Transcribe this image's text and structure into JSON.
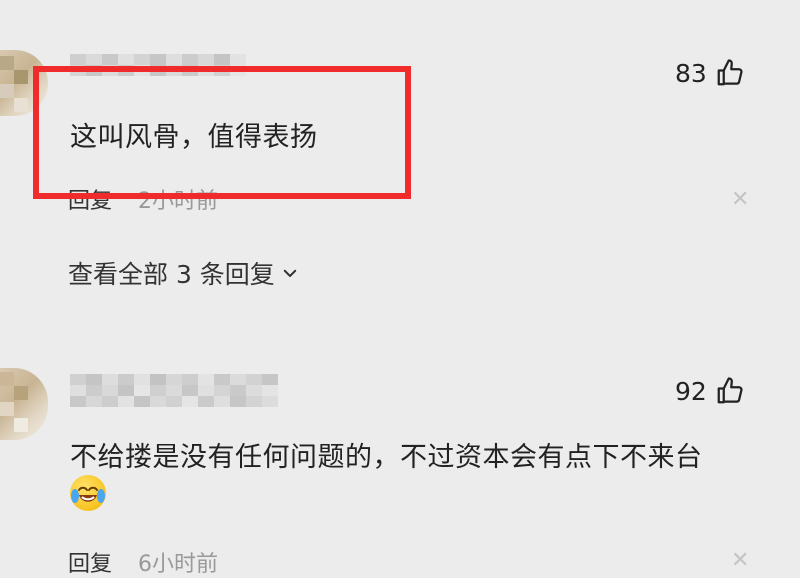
{
  "comments": [
    {
      "text": "这叫风骨，值得表扬",
      "likes": "83",
      "reply_label": "回复",
      "time": "2小时前",
      "view_all": "查看全部 3 条回复"
    },
    {
      "text": "不给搂是没有任何问题的，不过资本会有点下不来台",
      "likes": "92",
      "reply_label": "回复",
      "time": "6小时前"
    }
  ],
  "icons": {
    "like": "thumbs-up-icon",
    "close": "close-icon",
    "expand": "chevron-down-icon",
    "emoji": "crying-laughing-emoji"
  },
  "colors": {
    "highlight": "#f02b2b",
    "background": "#ececec"
  }
}
